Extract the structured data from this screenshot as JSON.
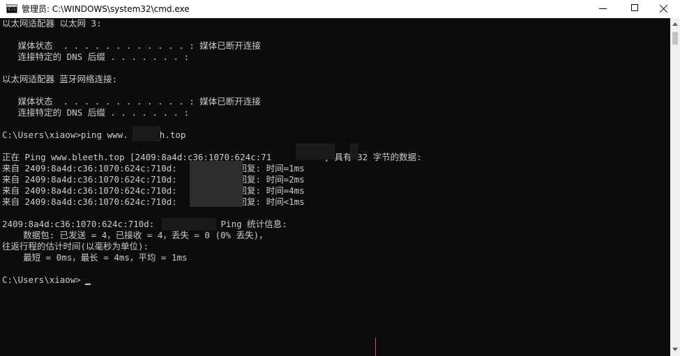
{
  "window": {
    "title": "管理员: C:\\WINDOWS\\system32\\cmd.exe",
    "icon": "cmd-icon",
    "controls": {
      "minimize_icon": "minimize-icon",
      "maximize_icon": "maximize-icon",
      "close_icon": "close-icon"
    }
  },
  "console": {
    "background": "#0c0c0c",
    "foreground": "#cccccc",
    "lines": [
      "以太网适配器 以太网 3:",
      "",
      "   媒体状态  . . . . . . . . . . . . : 媒体已断开连接",
      "   连接特定的 DNS 后缀 . . . . . . . :",
      "",
      "以太网适配器 蓝牙网络连接:",
      "",
      "   媒体状态  . . . . . . . . . . . . : 媒体已断开连接",
      "   连接特定的 DNS 后缀 . . . . . . . :",
      "",
      "C:\\Users\\xiaow>ping www.      h.top",
      "",
      "正在 Ping www.bleeth.top [2409:8a4d:c36:1070:624c:71          ] 具有 32 字节的数据:",
      "来自 2409:8a4d:c36:1070:624c:710d:          的回复: 时间=1ms",
      "来自 2409:8a4d:c36:1070:624c:710d:          的回复: 时间=2ms",
      "来自 2409:8a4d:c36:1070:624c:710d:          的回复: 时间=4ms",
      "来自 2409:8a4d:c36:1070:624c:710d:          的回复: 时间<1ms",
      "",
      "2409:8a4d:c36:1070:624c:710d:          的 Ping 统计信息:",
      "    数据包: 已发送 = 4，已接收 = 4，丢失 = 0 (0% 丢失)，",
      "往返行程的估计时间(以毫秒为单位):",
      "    最短 = 0ms，最长 = 4ms，平均 = 1ms",
      "",
      "C:\\Users\\xiaow>"
    ]
  }
}
